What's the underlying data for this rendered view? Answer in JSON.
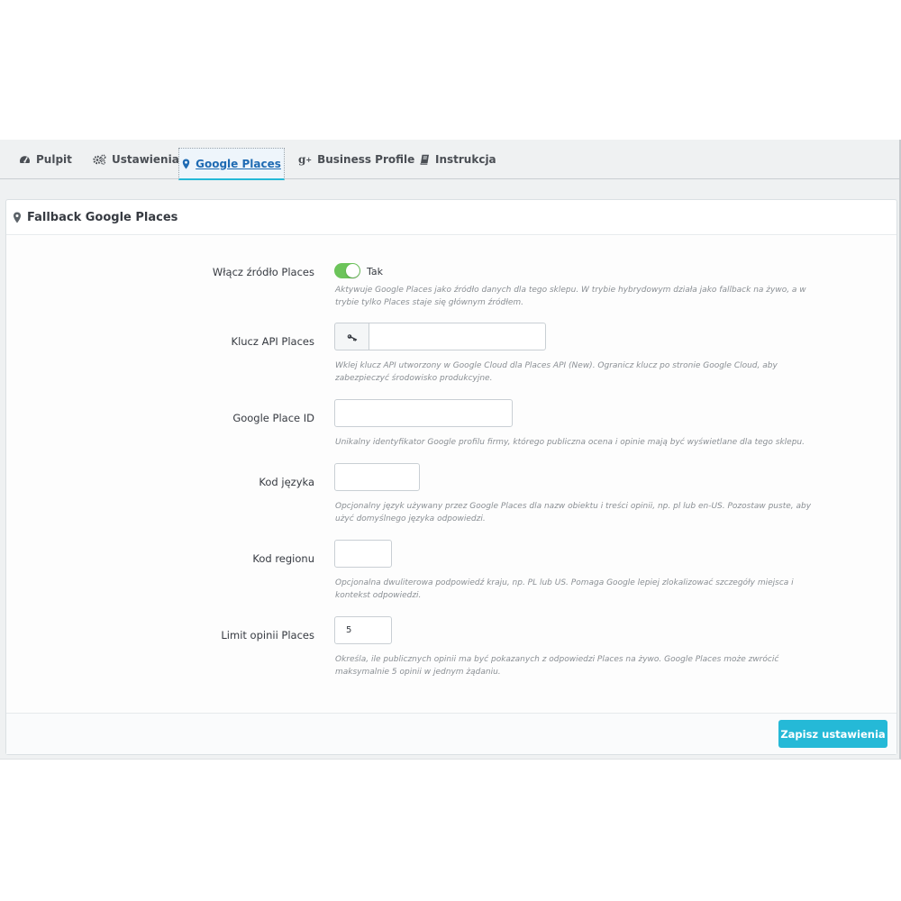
{
  "tabs": [
    {
      "label": "Pulpit",
      "icon": "dashboard-icon",
      "active": false
    },
    {
      "label": "Ustawienia",
      "icon": "cogs-icon",
      "active": false
    },
    {
      "label": "Google Places",
      "icon": "map-marker-icon",
      "active": true
    },
    {
      "label": "Business Profile",
      "icon": "google-plus-icon",
      "active": false
    },
    {
      "label": "Instrukcja",
      "icon": "book-icon",
      "active": false
    }
  ],
  "panel": {
    "title": "Fallback Google Places",
    "title_icon": "map-marker-icon"
  },
  "fields": {
    "enable": {
      "label": "Włącz źródło Places",
      "state_label": "Tak",
      "checked": true,
      "help": "Aktywuje Google Places jako źródło danych dla tego sklepu. W trybie hybrydowym działa jako fallback na żywo, a w trybie tylko Places staje się głównym źródłem."
    },
    "api_key": {
      "label": "Klucz API Places",
      "value": "",
      "addon_icon": "key-icon",
      "help": "Wklej klucz API utworzony w Google Cloud dla Places API (New). Ogranicz klucz po stronie Google Cloud, aby zabezpieczyć środowisko produkcyjne."
    },
    "place_id": {
      "label": "Google Place ID",
      "value": "",
      "help": "Unikalny identyfikator Google profilu firmy, którego publiczna ocena i opinie mają być wyświetlane dla tego sklepu."
    },
    "language": {
      "label": "Kod języka",
      "value": "",
      "help": "Opcjonalny język używany przez Google Places dla nazw obiektu i treści opinii, np. pl lub en-US. Pozostaw puste, aby użyć domyślnego języka odpowiedzi."
    },
    "region": {
      "label": "Kod regionu",
      "value": "",
      "help": "Opcjonalna dwuliterowa podpowiedź kraju, np. PL lub US. Pomaga Google lepiej zlokalizować szczegóły miejsca i kontekst odpowiedzi."
    },
    "review_limit": {
      "label": "Limit opinii Places",
      "value": "5",
      "help": "Określa, ile publicznych opinii ma być pokazanych z odpowiedzi Places na żywo. Google Places może zwrócić maksymalnie 5 opinii w jednym żądaniu."
    }
  },
  "footer": {
    "save_label": "Zapisz ustawienia"
  },
  "colors": {
    "accent": "#25b9d7",
    "toggle_on": "#6cc45a",
    "active_tab_text": "#1f6bb3"
  }
}
